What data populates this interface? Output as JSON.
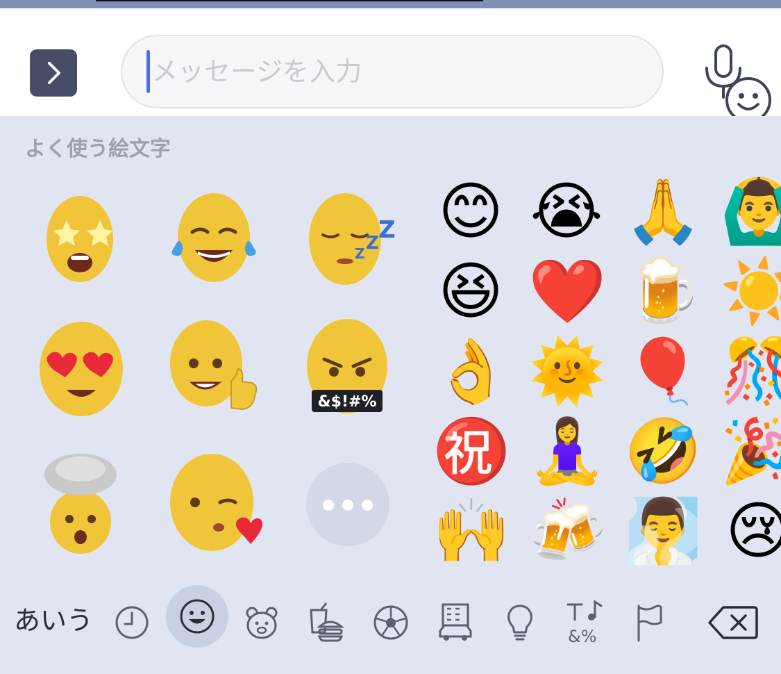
{
  "composer": {
    "expand_icon": "chevron-right-icon",
    "placeholder": "メッセージを入力",
    "emoji_icon": "smiley-face-icon",
    "mic_icon": "microphone-icon",
    "accent_color": "#4f6de8"
  },
  "keyboard": {
    "section_title": "よく使う絵文字",
    "memoji": [
      {
        "name": "memoji-star-struck",
        "caption": ""
      },
      {
        "name": "memoji-tears-of-joy",
        "caption": ""
      },
      {
        "name": "memoji-sleeping",
        "caption": ""
      },
      {
        "name": "memoji-heart-eyes",
        "caption": ""
      },
      {
        "name": "memoji-thumbs-up",
        "caption": ""
      },
      {
        "name": "memoji-cursing",
        "caption": "&$!#%"
      },
      {
        "name": "memoji-mind-blown",
        "caption": ""
      },
      {
        "name": "memoji-wink-heart",
        "caption": ""
      }
    ],
    "more_button_icon": "ellipsis-icon",
    "emoji_grid": [
      [
        "😊",
        "😭",
        "🙏",
        "🙆‍♂️"
      ],
      [
        "😆",
        "❤️",
        "🍺",
        "☀️"
      ],
      [
        "👌",
        "🌞",
        "🎈",
        "🎊"
      ],
      [
        "㊗️",
        "🧘‍♀️",
        "🤣",
        "🎉"
      ],
      [
        "🙌",
        "🍻",
        "🧖‍♂️",
        "😢"
      ]
    ],
    "categories": {
      "kana_label": "あいう",
      "items": [
        {
          "icon": "clock-icon",
          "active": false
        },
        {
          "icon": "smiley-icon",
          "active": true
        },
        {
          "icon": "bear-icon",
          "active": false
        },
        {
          "icon": "burger-icon",
          "active": false
        },
        {
          "icon": "soccer-ball-icon",
          "active": false
        },
        {
          "icon": "car-building-icon",
          "active": false
        },
        {
          "icon": "lightbulb-icon",
          "active": false
        },
        {
          "icon": "symbols-icon",
          "active": false
        },
        {
          "icon": "flag-icon",
          "active": false
        }
      ],
      "symbols_label": "&%",
      "delete_icon": "backspace-icon"
    }
  }
}
